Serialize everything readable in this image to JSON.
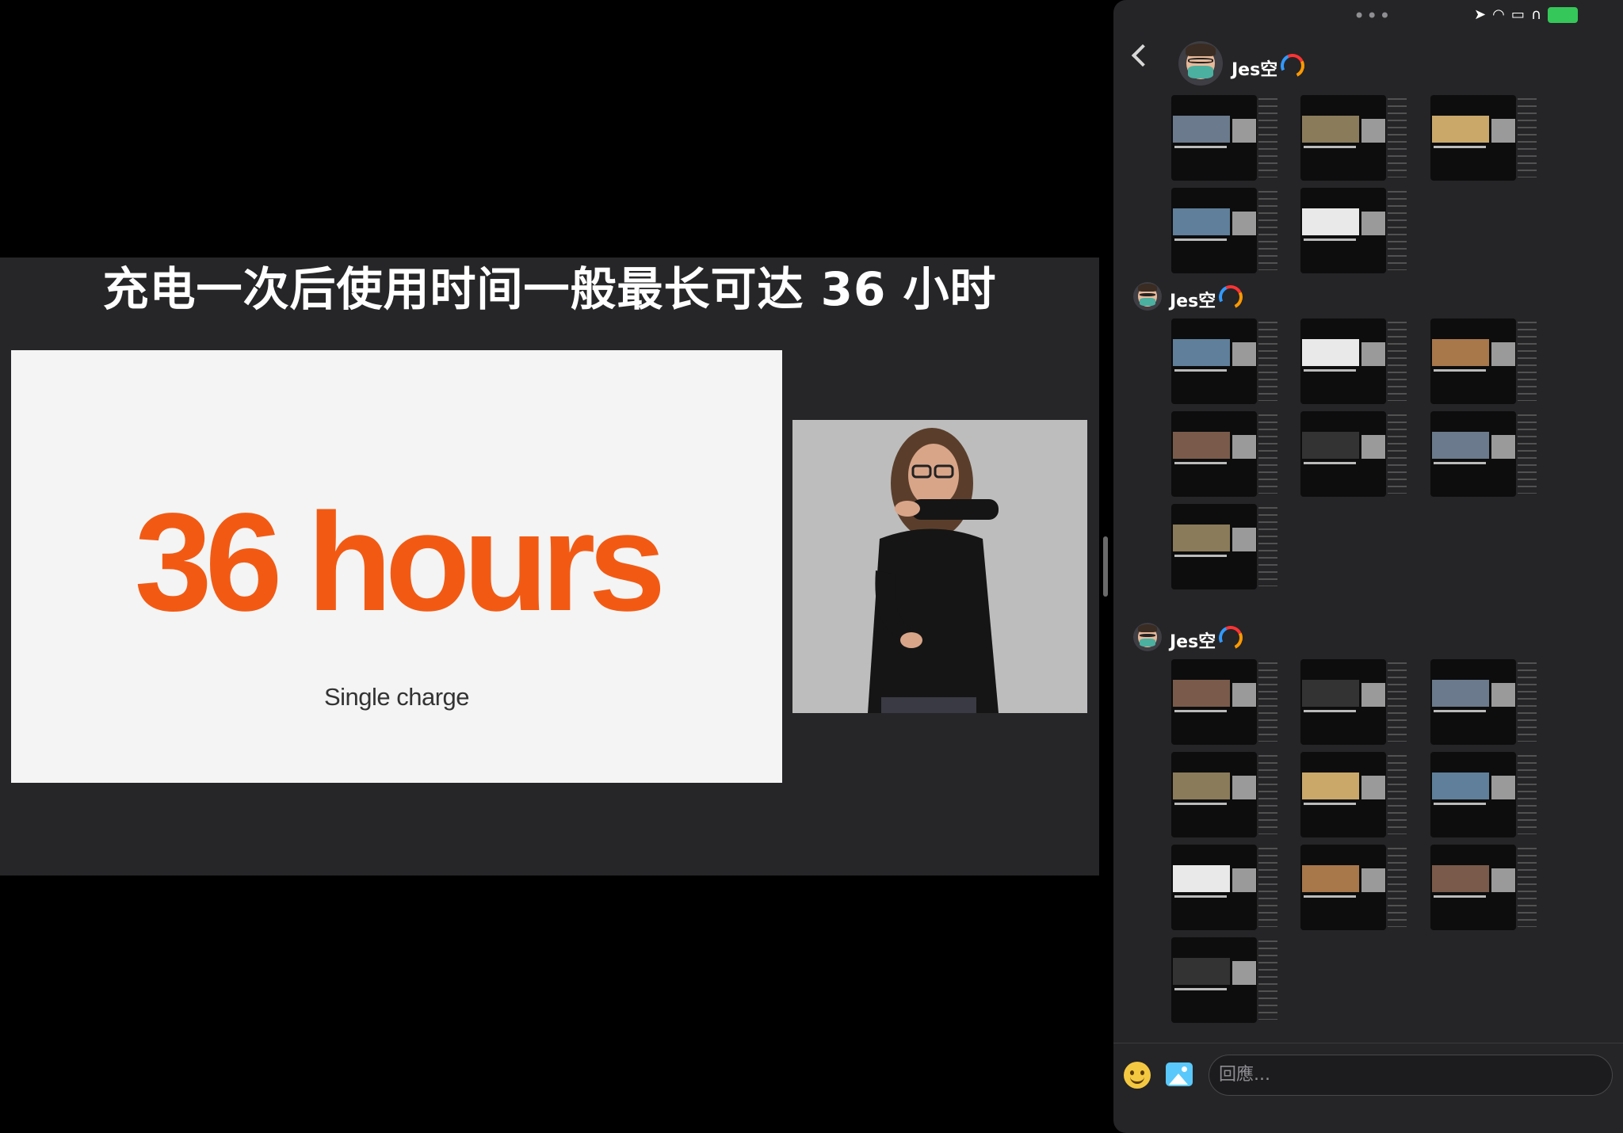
{
  "video": {
    "subtitle": "充电一次后使用时间一般最长可达 36 小时",
    "slide_big": "36 hours",
    "slide_sub": "Single charge",
    "accent_color": "#f25a14"
  },
  "chat": {
    "menu_icon": "more-dots",
    "status_icons": [
      "location-arrow-icon",
      "wifi-icon",
      "car-icon",
      "headphones-icon",
      "battery-charging-icon"
    ],
    "messages": [
      {
        "sender": "Jes空",
        "thumb_count": 5
      },
      {
        "sender": "Jes空",
        "thumb_count": 7
      },
      {
        "sender": "Jes空",
        "thumb_count": 10
      }
    ],
    "reply_placeholder": "回應..."
  }
}
